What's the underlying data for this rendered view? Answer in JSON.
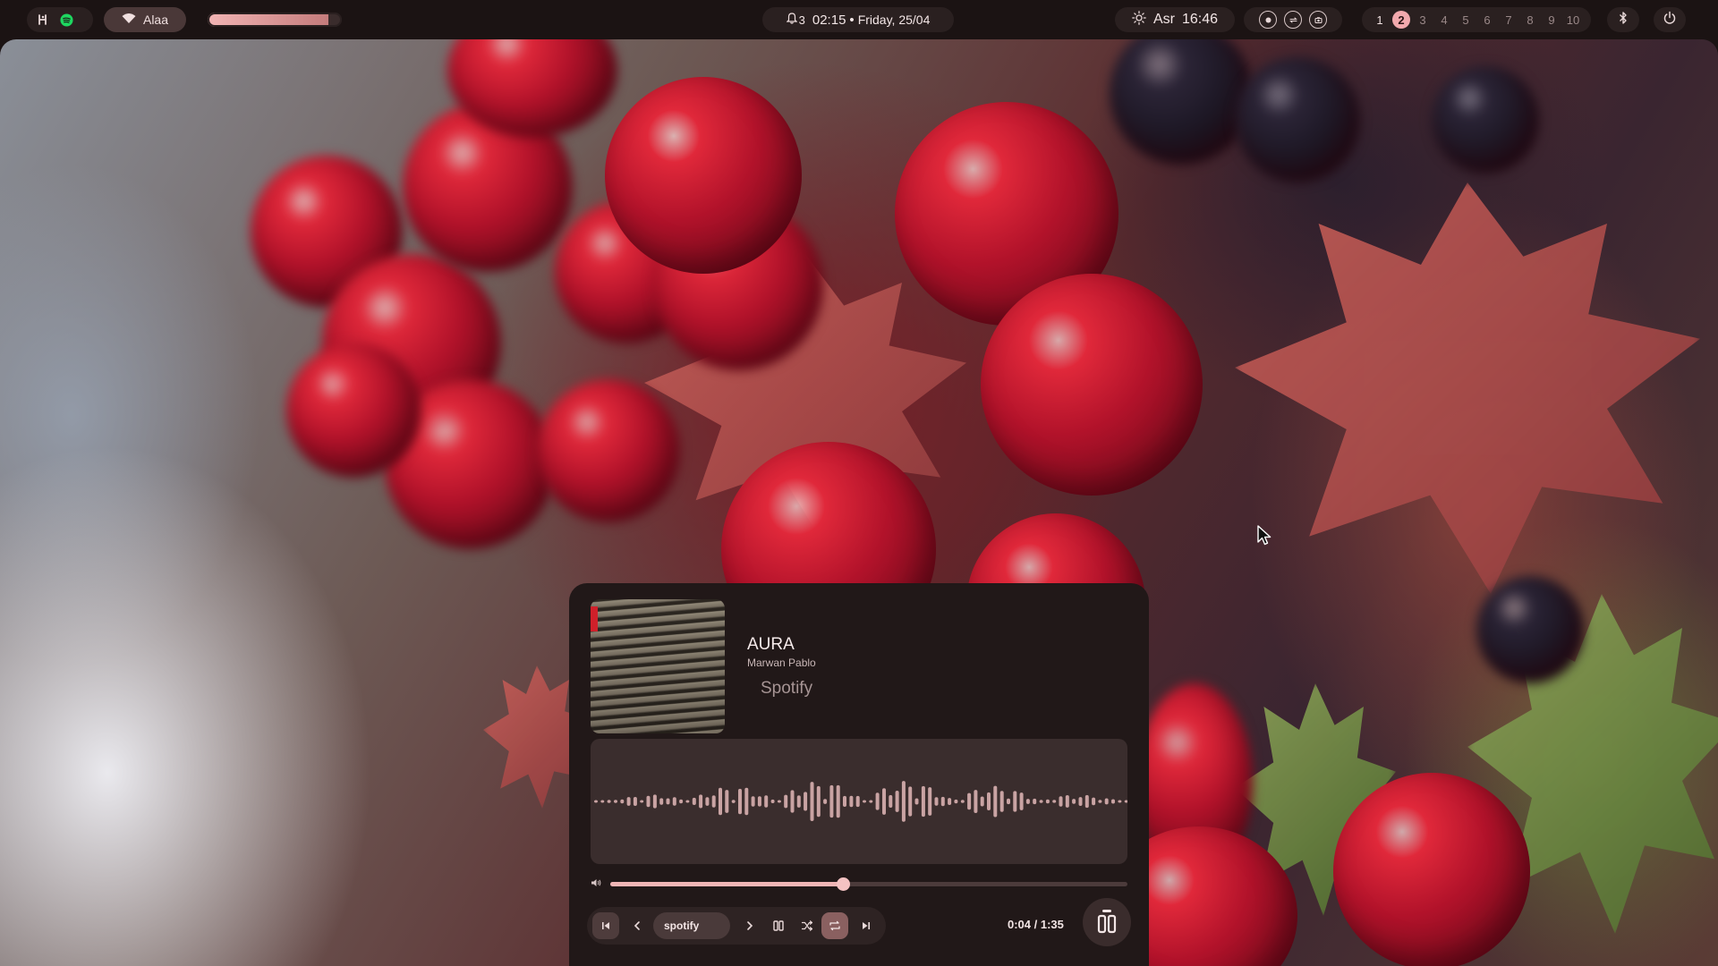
{
  "topbar": {
    "left_icons": [
      "hyprland-icon",
      "spotify-icon"
    ],
    "network_name": "Alaa",
    "brightness_level": 0.9,
    "notifications_count": "3",
    "clock": "02:15",
    "date": "Friday, 25/04",
    "date_separator": "•",
    "prayer_name": "Asr",
    "prayer_time": "16:46",
    "workspaces": [
      "1",
      "2",
      "3",
      "4",
      "5",
      "6",
      "7",
      "8",
      "9",
      "10"
    ],
    "active_workspace": "2"
  },
  "media": {
    "title": "AURA",
    "artist": "Marwan Pablo",
    "source": "Spotify",
    "player": "spotify",
    "elapsed": "0:04",
    "duration": "1:35",
    "time_display": "0:04 / 1:35",
    "progress": 0.45,
    "shuffle": false,
    "repeat": true
  },
  "colors": {
    "bar_bg": "#1b1313",
    "pill_bg": "#2a2020",
    "accent": "#f2a9ad",
    "panel_bg": "#211818",
    "wave_color": "#c9a3a3"
  }
}
